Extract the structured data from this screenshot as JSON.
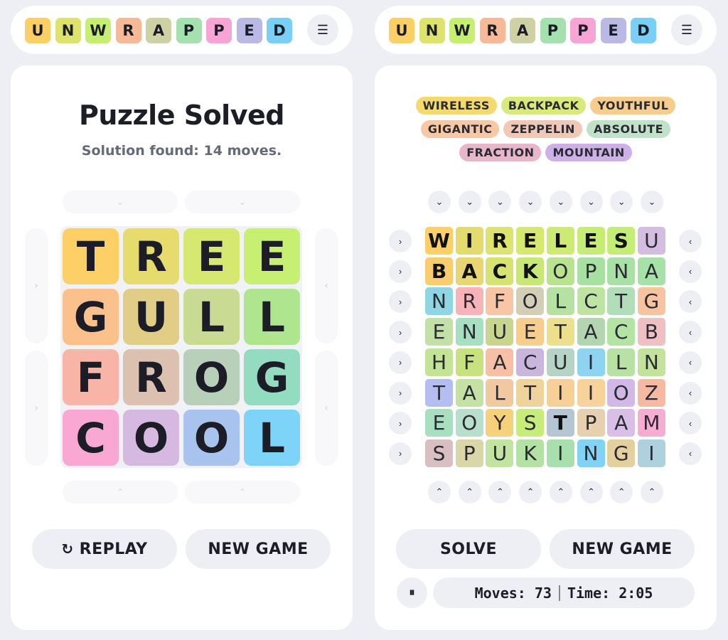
{
  "logo": {
    "letters": [
      "U",
      "N",
      "W",
      "R",
      "A",
      "P",
      "P",
      "E",
      "D"
    ],
    "colors": [
      "#fdd067",
      "#dde36c",
      "#c4ef72",
      "#f8b996",
      "#cfd1a4",
      "#a4e1ae",
      "#f8a4d4",
      "#bab9e6",
      "#79cff5"
    ]
  },
  "menu_icon": "☰",
  "left": {
    "title": "Puzzle Solved",
    "subtitle": "Solution found: 14 moves.",
    "grid": [
      [
        "T",
        "R",
        "E",
        "E"
      ],
      [
        "G",
        "U",
        "L",
        "L"
      ],
      [
        "F",
        "R",
        "O",
        "G"
      ],
      [
        "C",
        "O",
        "O",
        "L"
      ]
    ],
    "colors": [
      [
        "#fdd067",
        "#e6dc6d",
        "#d6e86f",
        "#c7ef72"
      ],
      [
        "#fbc18c",
        "#e1cd86",
        "#c9da92",
        "#b0e58f"
      ],
      [
        "#f8b4a6",
        "#dcc1b1",
        "#b8cfba",
        "#93dcc2"
      ],
      [
        "#f8a8d2",
        "#d5b9e0",
        "#a8c4ee",
        "#7ed3f8"
      ]
    ],
    "replay_label": "REPLAY",
    "new_game_label": "NEW GAME"
  },
  "right": {
    "words": [
      {
        "text": "WIRELESS",
        "color": "#f4d96c"
      },
      {
        "text": "BACKPACK",
        "color": "#d9ea7a"
      },
      {
        "text": "YOUTHFUL",
        "color": "#f7cd8d"
      },
      {
        "text": "GIGANTIC",
        "color": "#f8c7a4"
      },
      {
        "text": "ZEPPELIN",
        "color": "#f1c8b6"
      },
      {
        "text": "ABSOLUTE",
        "color": "#bfe2c9"
      },
      {
        "text": "FRACTION",
        "color": "#e7b6c9"
      },
      {
        "text": "MOUNTAIN",
        "color": "#ccb0e6"
      }
    ],
    "grid": [
      [
        "W",
        "I",
        "R",
        "E",
        "L",
        "E",
        "S",
        "U"
      ],
      [
        "B",
        "A",
        "C",
        "K",
        "O",
        "P",
        "N",
        "A"
      ],
      [
        "N",
        "R",
        "F",
        "O",
        "L",
        "C",
        "T",
        "G"
      ],
      [
        "E",
        "N",
        "U",
        "E",
        "T",
        "A",
        "C",
        "B"
      ],
      [
        "H",
        "F",
        "A",
        "C",
        "U",
        "I",
        "L",
        "N"
      ],
      [
        "T",
        "A",
        "L",
        "T",
        "I",
        "I",
        "O",
        "Z"
      ],
      [
        "E",
        "O",
        "Y",
        "S",
        "T",
        "P",
        "A",
        "M"
      ],
      [
        "S",
        "P",
        "U",
        "K",
        "I",
        "N",
        "G",
        "I"
      ]
    ],
    "colors": [
      [
        "#fdd067",
        "#e3db6e",
        "#dce36f",
        "#d6e870",
        "#cdea73",
        "#c6ec73",
        "#c3ed75",
        "#d3bde0"
      ],
      [
        "#f9cc6d",
        "#e7d672",
        "#d6e272",
        "#c8e776",
        "#b9e38e",
        "#a8e0a2",
        "#a9e0a6",
        "#a6e2a6"
      ],
      [
        "#8fd6e5",
        "#f8b3b9",
        "#f8c6a6",
        "#d3cfb5",
        "#b5e2a3",
        "#bfe3a2",
        "#b1ddb9",
        "#f8c4a0"
      ],
      [
        "#c2e0a8",
        "#a6e0c0",
        "#c7d58f",
        "#f7cd8d",
        "#ede08d",
        "#b3d6b0",
        "#b4e4a4",
        "#f0bfc2"
      ],
      [
        "#c3e395",
        "#c7e27f",
        "#f6bfa6",
        "#c9b6dc",
        "#b5d4c6",
        "#8ed4f0",
        "#b7e2a4",
        "#c5e29c"
      ],
      [
        "#b5bef0",
        "#c3e2a4",
        "#f2c8a0",
        "#eed39a",
        "#f7d098",
        "#f7d29b",
        "#d2b8e6",
        "#f7b9a2"
      ],
      [
        "#a7dfc0",
        "#b8dfcc",
        "#f7d07a",
        "#c8ec7a",
        "#b6c5d4",
        "#e6d0b0",
        "#d9bfe5",
        "#f7acd2"
      ],
      [
        "#d7bfc2",
        "#d9d6a7",
        "#c1e4a0",
        "#b4e2a4",
        "#a7e0ac",
        "#81d2f4",
        "#e3d09e",
        "#aed1de"
      ]
    ],
    "locked": [
      [
        1,
        1,
        1,
        1,
        1,
        1,
        1,
        0
      ],
      [
        1,
        1,
        1,
        1,
        0,
        0,
        0,
        0
      ],
      [
        0,
        0,
        0,
        0,
        0,
        0,
        0,
        0
      ],
      [
        0,
        0,
        0,
        0,
        0,
        0,
        0,
        0
      ],
      [
        0,
        0,
        0,
        0,
        0,
        0,
        0,
        0
      ],
      [
        0,
        0,
        0,
        0,
        0,
        0,
        0,
        0
      ],
      [
        0,
        0,
        0,
        0,
        1,
        0,
        0,
        0
      ],
      [
        0,
        0,
        0,
        0,
        0,
        0,
        0,
        0
      ]
    ],
    "solve_label": "SOLVE",
    "new_game_label": "NEW GAME",
    "pause_icon": "⏸",
    "moves_text": "Moves: 73",
    "time_text": "Time: 2:05"
  }
}
